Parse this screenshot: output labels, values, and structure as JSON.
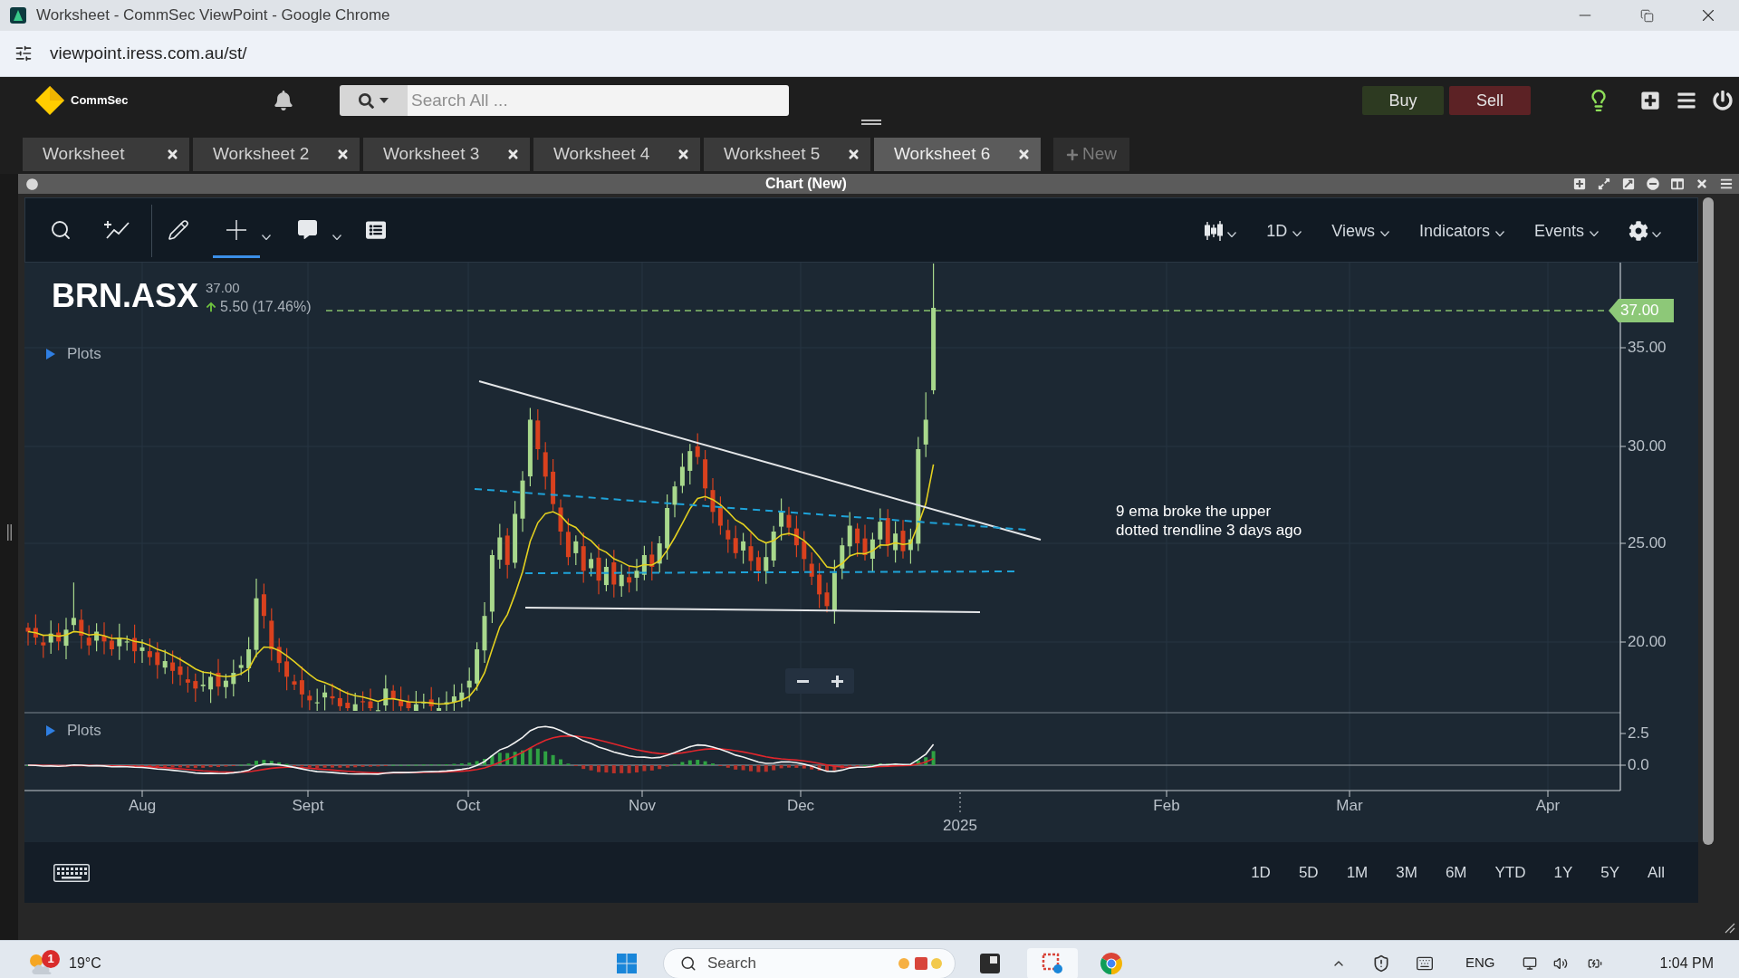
{
  "browser": {
    "title": "Worksheet - CommSec ViewPoint - Google Chrome",
    "url": "viewpoint.iress.com.au/st/"
  },
  "header": {
    "logo": "CommSec",
    "search": {
      "placeholder": "Search All ..."
    },
    "trade_buttons": [
      {
        "label": "Buy",
        "kind": "buy"
      },
      {
        "label": "Sell",
        "kind": "sell"
      }
    ]
  },
  "worksheet_tabs": [
    {
      "label": "Worksheet",
      "selected": false
    },
    {
      "label": "Worksheet 2",
      "selected": false
    },
    {
      "label": "Worksheet 3",
      "selected": false
    },
    {
      "label": "Worksheet 4",
      "selected": false
    },
    {
      "label": "Worksheet 5",
      "selected": false
    },
    {
      "label": "Worksheet 6",
      "selected": true
    }
  ],
  "new_tab": {
    "label": "New"
  },
  "panel": {
    "title": "Chart (New)"
  },
  "toolbar": {
    "tools": [
      {
        "kind": "search",
        "selected": false,
        "menu": false
      },
      {
        "kind": "trendline",
        "selected": false,
        "menu": false
      },
      {
        "kind": "draw",
        "selected": false,
        "menu": false
      },
      {
        "kind": "crosshair",
        "selected": true,
        "menu": true
      },
      {
        "kind": "comment",
        "selected": false,
        "menu": true
      },
      {
        "kind": "layout",
        "selected": false,
        "menu": false
      }
    ],
    "menus": [
      {
        "label": "1D"
      },
      {
        "label": "Views"
      },
      {
        "label": "Indicators"
      },
      {
        "label": "Events"
      }
    ]
  },
  "chart": {
    "symbol": "BRN.ASX",
    "last": "37.00",
    "change": "5.50 (17.46%)",
    "change_positive": true,
    "price_plots": {
      "label": "Plots",
      "expanded": false
    },
    "price_flag": "37.00",
    "price_ticks": [
      "35.00",
      "30.00",
      "25.00",
      "20.00"
    ],
    "annotation": [
      "9 ema broke the upper",
      "dotted trendline 3 days ago"
    ],
    "indicator_plots": {
      "label": "Plots",
      "expanded": false
    },
    "indicator_ticks": [
      "2.5",
      "0.0"
    ],
    "time_labels": [
      {
        "label": "Aug",
        "kind": "month"
      },
      {
        "label": "Sept",
        "kind": "month"
      },
      {
        "label": "Oct",
        "kind": "month"
      },
      {
        "label": "Nov",
        "kind": "month"
      },
      {
        "label": "Dec",
        "kind": "month"
      },
      {
        "label": "2025",
        "kind": "year"
      },
      {
        "label": "Feb",
        "kind": "month"
      },
      {
        "label": "Mar",
        "kind": "month"
      },
      {
        "label": "Apr",
        "kind": "month"
      }
    ]
  },
  "range_buttons": [
    {
      "label": "1D"
    },
    {
      "label": "5D"
    },
    {
      "label": "1M"
    },
    {
      "label": "3M"
    },
    {
      "label": "6M"
    },
    {
      "label": "YTD"
    },
    {
      "label": "1Y"
    },
    {
      "label": "5Y"
    },
    {
      "label": "All"
    }
  ],
  "taskbar": {
    "notification_count": "1",
    "temperature": "19°C",
    "search": {
      "placeholder": "Search"
    },
    "language": "ENG",
    "time": "1:04 PM"
  }
}
